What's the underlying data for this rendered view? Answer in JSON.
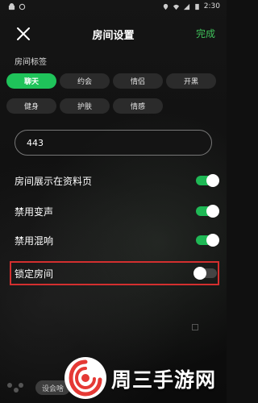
{
  "status_bar": {
    "time": "2:30"
  },
  "header": {
    "title": "房间设置",
    "done_label": "完成"
  },
  "tags_section": {
    "label": "房间标签",
    "tags": [
      {
        "label": "聊天",
        "selected": true
      },
      {
        "label": "约会",
        "selected": false
      },
      {
        "label": "情侣",
        "selected": false
      },
      {
        "label": "开黑",
        "selected": false
      },
      {
        "label": "健身",
        "selected": false
      },
      {
        "label": "护肤",
        "selected": false
      },
      {
        "label": "情感",
        "selected": false
      }
    ]
  },
  "room_number_input": {
    "value": "443"
  },
  "settings": [
    {
      "label": "房间展示在资料页",
      "enabled": true
    },
    {
      "label": "禁用变声",
      "enabled": true
    },
    {
      "label": "禁用混响",
      "enabled": true
    },
    {
      "label": "锁定房间",
      "enabled": false
    }
  ],
  "background": {
    "game_button_label": "设会啥"
  },
  "watermark": {
    "text": "周三手游网"
  },
  "colors": {
    "accent": "#1fc35a",
    "done": "#3fc15a",
    "highlight": "#d32f2f"
  }
}
